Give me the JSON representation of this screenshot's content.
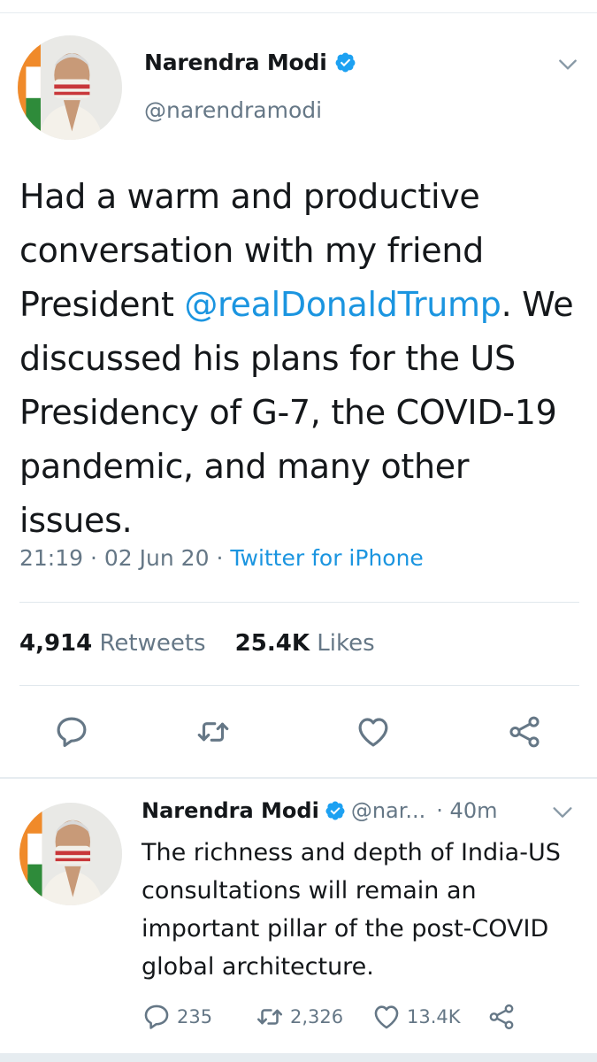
{
  "main_tweet": {
    "author": {
      "name": "Narendra Modi",
      "handle": "@narendramodi",
      "verified_icon": "verified-badge-icon",
      "avatar": "profile-photo"
    },
    "text": {
      "part1": "Had a warm and productive conversation with my friend President ",
      "mention": "@realDonaldTrump",
      "part2": ". We discussed his plans for the US Presidency of G-7, the COVID-19 pandemic, and many other issues."
    },
    "time": "21:19",
    "date": "02 Jun 20",
    "separator": "·",
    "source": "Twitter for iPhone",
    "stats": {
      "retweets_count": "4,914",
      "retweets_label": "Retweets",
      "likes_count": "25.4K",
      "likes_label": "Likes"
    },
    "actions": [
      "reply-icon",
      "retweet-icon",
      "like-icon",
      "share-icon"
    ]
  },
  "reply_tweet": {
    "author": {
      "name": "Narendra Modi",
      "handle": "@nar...",
      "time": "· 40m"
    },
    "text": "The richness and depth of India-US consultations will remain an important pillar of the post-COVID global architecture.",
    "counts": {
      "replies": "235",
      "retweets": "2,326",
      "likes": "13.4K"
    }
  },
  "colors": {
    "link_blue": "#1b95e0",
    "secondary_text": "#657786",
    "primary_text": "#14171a",
    "divider": "#e1e8ed"
  }
}
